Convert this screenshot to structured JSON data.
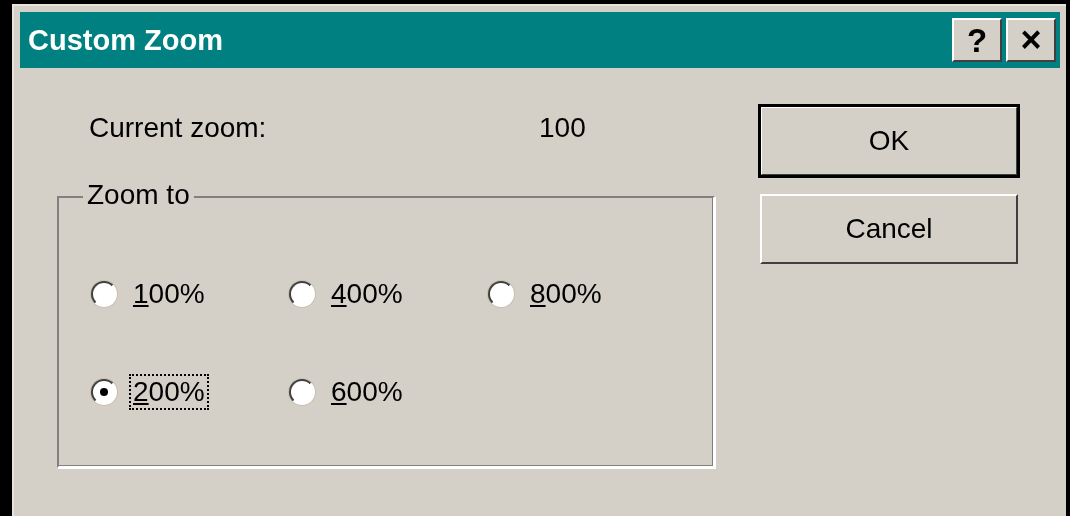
{
  "window": {
    "title": "Custom Zoom",
    "title_buttons": [
      {
        "kind": "help",
        "label": "?"
      },
      {
        "kind": "close",
        "label": "×"
      }
    ]
  },
  "current_zoom": {
    "label": "Current zoom:",
    "value": "100"
  },
  "group": {
    "title": "Zoom to",
    "options": [
      {
        "mnemonic": "1",
        "rest": "00%",
        "selected": false,
        "focused": false
      },
      {
        "mnemonic": "4",
        "rest": "00%",
        "selected": false,
        "focused": false
      },
      {
        "mnemonic": "8",
        "rest": "00%",
        "selected": false,
        "focused": false
      },
      {
        "mnemonic": "2",
        "rest": "00%",
        "selected": true,
        "focused": true
      },
      {
        "mnemonic": "6",
        "rest": "00%",
        "selected": false,
        "focused": false
      }
    ]
  },
  "buttons": [
    {
      "label": "OK",
      "default": true
    },
    {
      "label": "Cancel",
      "default": false
    }
  ]
}
